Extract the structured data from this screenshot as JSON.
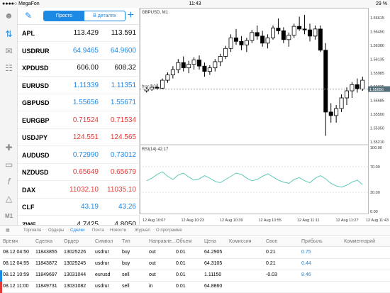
{
  "status": {
    "carrier": "●●●●○ MegaFon",
    "time": "11:43",
    "battery": "29 %"
  },
  "colors": {
    "accent": "#1e88e5",
    "bid_up": "#1e88e5",
    "bid_down": "#e53935",
    "candle_up": "#ffffff",
    "candle_down": "#000000",
    "rsi_line": "#5fc9b9",
    "buy_marker": "#00a651",
    "sell_marker": "#e53935"
  },
  "sidebar": {
    "icons": [
      "person-icon",
      "chart-arrows-icon",
      "chat-icon",
      "document-icon",
      "crosshair-icon",
      "candle-icon",
      "function-icon",
      "shapes-icon",
      "timeframe-icon",
      "calendar-icon"
    ],
    "timeframe": "M1"
  },
  "quotes": {
    "tabs": [
      "Просто",
      "В деталях"
    ],
    "rows": [
      {
        "symbol": "APL",
        "bid": "113.429",
        "ask": "113.591",
        "color": "blk"
      },
      {
        "symbol": "USDRUR",
        "bid": "64.9465",
        "ask": "64.9600",
        "color": "blue"
      },
      {
        "symbol": "XPDUSD",
        "bid": "606.00",
        "ask": "608.32",
        "color": "blk"
      },
      {
        "symbol": "EURUSD",
        "bid": "1.11339",
        "ask": "1.11351",
        "color": "blue"
      },
      {
        "symbol": "GBPUSD",
        "bid": "1.55656",
        "ask": "1.55671",
        "color": "blue"
      },
      {
        "symbol": "EURGBP",
        "bid": "0.71524",
        "ask": "0.71534",
        "color": "red"
      },
      {
        "symbol": "USDJPY",
        "bid": "124.551",
        "ask": "124.565",
        "color": "red"
      },
      {
        "symbol": "AUDUSD",
        "bid": "0.72990",
        "ask": "0.73012",
        "color": "blue"
      },
      {
        "symbol": "NZDUSD",
        "bid": "0.65649",
        "ask": "0.65679",
        "color": "red"
      },
      {
        "symbol": "DAX",
        "bid": "11032.10",
        "ask": "11035.10",
        "color": "red"
      },
      {
        "symbol": "CLF",
        "bid": "43.19",
        "ask": "43.26",
        "color": "blue"
      },
      {
        "symbol": "ZWF",
        "bid": "4.7425",
        "ask": "4.8050",
        "color": "blk"
      }
    ]
  },
  "chart": {
    "title": "GBPUSD, M1",
    "buy_label": "buy 0.04",
    "rsi_label": "RSI(14) 42.17",
    "price_ticks": [
      "1.56615",
      "1.56450",
      "1.56300",
      "1.56135",
      "1.55985",
      "1.55835",
      "1.55685",
      "1.55500",
      "1.55350",
      "1.55210"
    ],
    "current_price": "1.55656",
    "rsi_ticks": [
      "100.00",
      "70.00",
      "30.00",
      "0.00"
    ],
    "time_ticks": [
      "12 Aug 10:07",
      "12 Aug 10:23",
      "12 Aug 10:39",
      "12 Aug 10:55",
      "12 Aug 11:11",
      "12 Aug 11:27",
      "12 Aug 11:43"
    ]
  },
  "chart_data": {
    "type": "candlestick",
    "symbol": "GBPUSD",
    "timeframe": "M1",
    "x": [
      "12 Aug 10:07",
      "12 Aug 10:23",
      "12 Aug 10:39",
      "12 Aug 10:55",
      "12 Aug 11:11",
      "12 Aug 11:27",
      "12 Aug 11:43"
    ],
    "ylim": [
      1.5515,
      1.567
    ],
    "candles": [
      [
        1.5576,
        1.558,
        1.5574,
        1.5578
      ],
      [
        1.5578,
        1.5583,
        1.5576,
        1.558
      ],
      [
        1.558,
        1.5584,
        1.5577,
        1.5579
      ],
      [
        1.5579,
        1.559,
        1.5578,
        1.5588
      ],
      [
        1.5588,
        1.5597,
        1.5585,
        1.5594
      ],
      [
        1.5594,
        1.5604,
        1.559,
        1.56
      ],
      [
        1.56,
        1.5612,
        1.5596,
        1.5608
      ],
      [
        1.5608,
        1.5615,
        1.5598,
        1.5602
      ],
      [
        1.5602,
        1.561,
        1.5596,
        1.5606
      ],
      [
        1.5606,
        1.5614,
        1.56,
        1.5611
      ],
      [
        1.5611,
        1.5616,
        1.56,
        1.5604
      ],
      [
        1.5604,
        1.5608,
        1.5592,
        1.5598
      ],
      [
        1.5598,
        1.5605,
        1.5594,
        1.5602
      ],
      [
        1.5602,
        1.5612,
        1.5598,
        1.5609
      ],
      [
        1.5609,
        1.5618,
        1.5604,
        1.5615
      ],
      [
        1.5615,
        1.5627,
        1.5612,
        1.5624
      ],
      [
        1.5624,
        1.564,
        1.562,
        1.5636
      ],
      [
        1.5636,
        1.5646,
        1.5628,
        1.5632
      ],
      [
        1.5632,
        1.5638,
        1.5622,
        1.5628
      ],
      [
        1.5628,
        1.5636,
        1.562,
        1.5633
      ],
      [
        1.5633,
        1.5645,
        1.563,
        1.5642
      ],
      [
        1.5642,
        1.565,
        1.5634,
        1.5638
      ],
      [
        1.5638,
        1.5644,
        1.5626,
        1.563
      ],
      [
        1.563,
        1.564,
        1.5624,
        1.5636
      ],
      [
        1.5636,
        1.565,
        1.5634,
        1.5647
      ],
      [
        1.5647,
        1.5658,
        1.564,
        1.5644
      ],
      [
        1.5644,
        1.5648,
        1.563,
        1.5634
      ],
      [
        1.5634,
        1.5642,
        1.5626,
        1.5639
      ],
      [
        1.5639,
        1.5652,
        1.5636,
        1.5649
      ],
      [
        1.5649,
        1.566,
        1.5644,
        1.5646
      ],
      [
        1.5646,
        1.5662,
        1.564,
        1.5645
      ],
      [
        1.5645,
        1.5652,
        1.5632,
        1.5638
      ],
      [
        1.5638,
        1.565,
        1.5634,
        1.5646
      ],
      [
        1.5646,
        1.565,
        1.562,
        1.5622
      ],
      [
        1.5622,
        1.563,
        1.5525,
        1.5552
      ],
      [
        1.5552,
        1.5562,
        1.554,
        1.5548
      ],
      [
        1.5548,
        1.556,
        1.554,
        1.5556
      ],
      [
        1.5556,
        1.5572,
        1.5552,
        1.5568
      ],
      [
        1.5568,
        1.558,
        1.556,
        1.5576
      ],
      [
        1.5576,
        1.5586,
        1.5568,
        1.5583
      ],
      [
        1.5583,
        1.559,
        1.5574,
        1.5578
      ],
      [
        1.5578,
        1.5592,
        1.5576,
        1.5588
      ]
    ],
    "buy_level": 1.5578,
    "rsi": {
      "name": "RSI(14)",
      "ylim": [
        0,
        100
      ],
      "values": [
        48,
        52,
        58,
        62,
        55,
        50,
        57,
        60,
        54,
        49,
        51,
        56,
        52,
        47,
        45,
        50,
        55,
        60,
        58,
        52,
        48,
        50,
        55,
        59,
        54,
        49,
        46,
        44,
        50,
        53,
        48,
        45,
        52,
        56,
        51,
        44,
        40,
        38,
        41,
        46,
        49,
        42
      ]
    }
  },
  "tabs": [
    "Торговля",
    "Ордеры",
    "Сделки",
    "Почта",
    "Новости",
    "Журнал",
    "О программе"
  ],
  "deals": {
    "headers": [
      "Время",
      "Сделка",
      "Ордер",
      "Символ",
      "Тип",
      "Направле...",
      "Объем",
      "Цена",
      "Комиссия",
      "Своп",
      "Прибыль",
      "Комментарий"
    ],
    "rows": [
      {
        "time": "08.12 04:50",
        "deal": "11843855",
        "order": "13025226",
        "symbol": "usdrur",
        "type": "buy",
        "dir": "out",
        "volume": "0.01",
        "price": "64.2905",
        "commission": "",
        "swap": "0.21",
        "profit": "0.75",
        "comment": "",
        "mark": "#fff"
      },
      {
        "time": "08.12 04:55",
        "deal": "11843872",
        "order": "13025245",
        "symbol": "usdrur",
        "type": "buy",
        "dir": "out",
        "volume": "0.01",
        "price": "64.3105",
        "commission": "",
        "swap": "0.21",
        "profit": "0.44",
        "comment": "",
        "mark": "#fff"
      },
      {
        "time": "08.12 10:59",
        "deal": "11849697",
        "order": "13031044",
        "symbol": "eurusd",
        "type": "sell",
        "dir": "out",
        "volume": "0.01",
        "price": "1.11150",
        "commission": "",
        "swap": "-0.03",
        "profit": "8.46",
        "comment": "",
        "mark": "#1e88e5"
      },
      {
        "time": "08.12 11:00",
        "deal": "11849731",
        "order": "13031082",
        "symbol": "usdrur",
        "type": "sell",
        "dir": "in",
        "volume": "0.01",
        "price": "64.8860",
        "commission": "",
        "swap": "",
        "profit": "",
        "comment": "",
        "mark": "#e53935"
      }
    ]
  }
}
